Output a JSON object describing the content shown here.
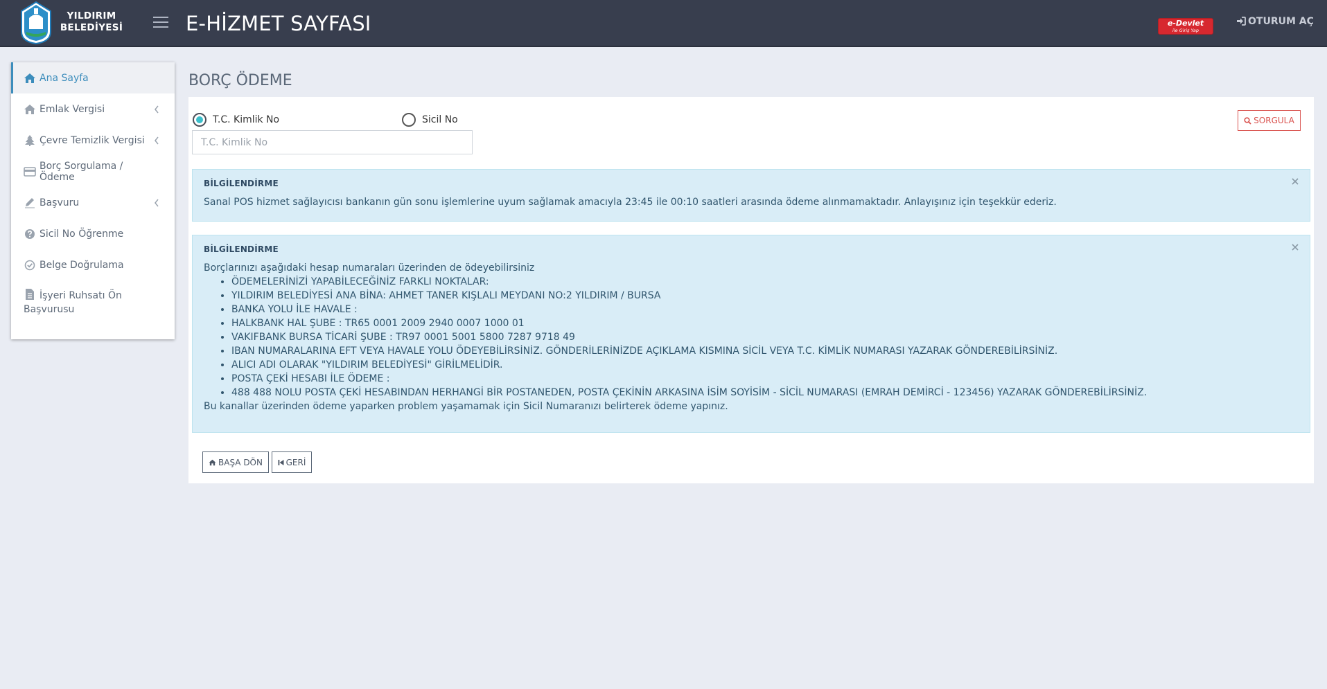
{
  "header": {
    "brand_line1": "YILDIRIM",
    "brand_line2": "BELEDİYESİ",
    "title": "E-HİZMET SAYFASI",
    "edevlet_label": "e-Devlet",
    "edevlet_sub": "ile Giriş Yap",
    "login_label": "OTURUM AÇ",
    "accent_color": "#383e4e"
  },
  "sidebar": {
    "items": [
      {
        "label": "Ana Sayfa",
        "icon": "home-icon"
      },
      {
        "label": "Emlak Vergisi",
        "icon": "home-icon"
      },
      {
        "label": "Çevre Temizlik Vergisi",
        "icon": "tree-icon"
      },
      {
        "label": "Borç Sorgulama / Ödeme",
        "icon": "credit-card-icon"
      },
      {
        "label": "Başvuru",
        "icon": "pencil-icon"
      },
      {
        "label": "Sicil No Öğrenme",
        "icon": "question-circle-icon"
      },
      {
        "label": "Belge Doğrulama",
        "icon": "check-circle-icon"
      },
      {
        "label": "İşyeri Ruhsatı Ön Başvurusu",
        "icon": "file-icon"
      }
    ]
  },
  "main": {
    "section_title": "BORÇ ÖDEME",
    "radio_tc": "T.C. Kimlik No",
    "radio_sicil": "Sicil No",
    "input_placeholder": "T.C. Kimlik No",
    "query_button": "SORGULA",
    "alert1": {
      "title": "BİLGİLENDİRME",
      "text": "Sanal POS hizmet sağlayıcısı bankanın gün sonu işlemlerine uyum sağlamak amacıyla 23:45 ile 00:10 saatleri arasında ödeme alınmamaktadır. Anlayışınız için teşekkür ederiz."
    },
    "alert2": {
      "title": "BİLGİLENDİRME",
      "intro": "Borçlarınızı aşağıdaki hesap numaraları üzerinden de ödeyebilirsiniz",
      "items": [
        "ÖDEMELERİNİZİ YAPABİLECEĞİNİZ FARKLI NOKTALAR:",
        "YILDIRIM BELEDİYESİ ANA BİNA: AHMET TANER KIŞLALI MEYDANI NO:2 YILDIRIM / BURSA",
        "BANKA YOLU İLE HAVALE :",
        "HALKBANK HAL ŞUBE : TR65 0001 2009 2940 0007 1000 01",
        "VAKIFBANK BURSA TİCARİ ŞUBE : TR97 0001 5001 5800 7287 9718 49",
        "IBAN NUMARALARINA EFT VEYA HAVALE YOLU ÖDEYEBİLİRSİNİZ. GÖNDERİLERİNİZDE AÇIKLAMA KISMINA SİCİL VEYA T.C. KİMLİK NUMARASI YAZARAK GÖNDEREBİLİRSİNİZ.",
        "ALICI ADI OLARAK \"YILDIRIM BELEDİYESİ\" GİRİLMELİDİR.",
        "POSTA ÇEKİ HESABI İLE ÖDEME :",
        "488 488 NOLU POSTA ÇEKİ HESABINDAN HERHANGİ BİR POSTANEDEN, POSTA ÇEKİNİN ARKASINA İSİM SOYİSİM - SİCİL NUMARASI (EMRAH DEMİRCİ - 123456) YAZARAK GÖNDEREBİLİRSİNİZ."
      ],
      "outro": "Bu kanallar üzerinden ödeme yaparken problem yaşamamak için Sicil Numaranızı belirterek ödeme yapınız."
    },
    "home_button": "BAŞA DÖN",
    "back_button": "GERİ"
  }
}
